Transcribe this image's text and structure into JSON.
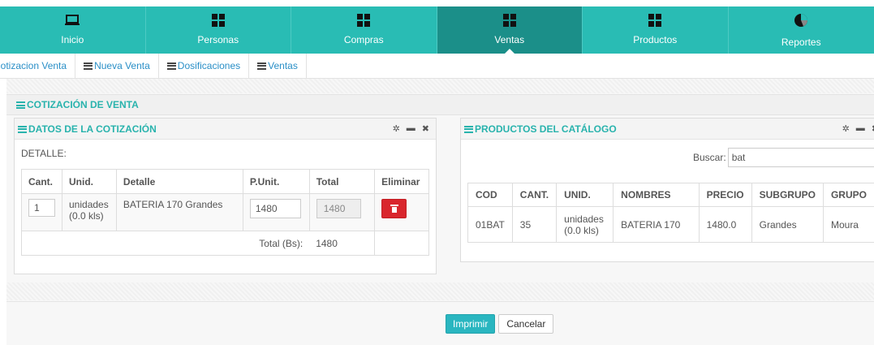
{
  "topnav": [
    {
      "label": "Inicio",
      "icon": "laptop-icon",
      "active": false
    },
    {
      "label": "Personas",
      "icon": "grid-icon",
      "active": false
    },
    {
      "label": "Compras",
      "icon": "grid-icon",
      "active": false
    },
    {
      "label": "Ventas",
      "icon": "grid-icon",
      "active": true
    },
    {
      "label": "Productos",
      "icon": "grid-icon",
      "active": false
    },
    {
      "label": "Reportes",
      "icon": "pie-chart-icon",
      "active": false
    }
  ],
  "subnav": [
    {
      "label": "Cotizacion Venta",
      "icon": ""
    },
    {
      "label": "Nueva Venta",
      "icon": "list-icon"
    },
    {
      "label": "Dosificaciones",
      "icon": "list-icon"
    },
    {
      "label": "Ventas",
      "icon": "list-icon"
    }
  ],
  "main_title": "COTIZACIÓN DE VENTA",
  "left_panel": {
    "title": "DATOS DE LA COTIZACIÓN",
    "detalle_label": "DETALLE:",
    "headers": [
      "Cant.",
      "Unid.",
      "Detalle",
      "P.Unit.",
      "Total",
      "Eliminar"
    ],
    "row": {
      "cant": "1",
      "unid": "unidades (0.0 kls)",
      "detalle": "BATERIA 170 Grandes",
      "punit": "1480",
      "total": "1480"
    },
    "total_label": "Total (Bs):",
    "total_value": "1480"
  },
  "right_panel": {
    "title": "PRODUCTOS DEL CATÁLOGO",
    "search_label": "Buscar:",
    "search_value": "bat",
    "headers": [
      "COD",
      "CANT.",
      "UNID.",
      "NOMBRES",
      "PRECIO",
      "SUBGRUPO",
      "GRUPO"
    ],
    "rows": [
      {
        "cod": "01BAT",
        "cant": "35",
        "unid": "unidades (0.0 kls)",
        "nombres": "BATERIA 170",
        "precio": "1480.0",
        "subgrupo": "Grandes",
        "grupo": "Moura"
      }
    ]
  },
  "buttons": {
    "print": "Imprimir",
    "cancel": "Cancelar"
  },
  "colors": {
    "nav": "#29bcb4",
    "nav_active": "#1b8f89",
    "title_teal": "#29b3ad",
    "delete_red": "#d9262d",
    "primary": "#2ab6c0",
    "link_blue": "#2a8fc7"
  }
}
